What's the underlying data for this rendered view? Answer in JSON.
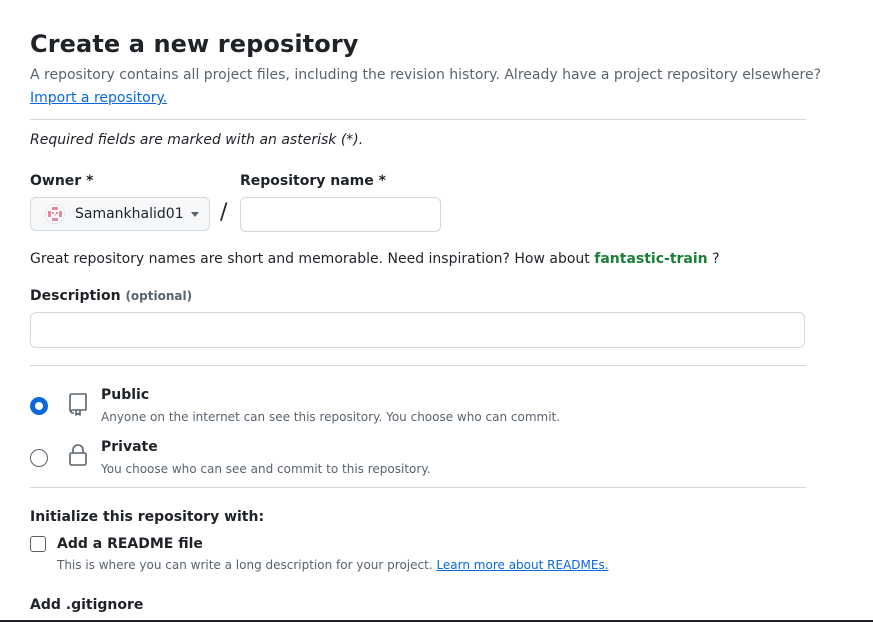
{
  "header": {
    "title": "Create a new repository",
    "subtitle": "A repository contains all project files, including the revision history. Already have a project repository elsewhere?",
    "import_link": "Import a repository."
  },
  "form": {
    "required_note": "Required fields are marked with an asterisk (*).",
    "owner": {
      "label": "Owner *",
      "value": "Samankhalid01",
      "avatar_icon": "identicon-avatar"
    },
    "separator": "/",
    "repo_name": {
      "label": "Repository name *",
      "value": "",
      "placeholder": ""
    },
    "hint": {
      "prefix": "Great repository names are short and memorable. Need inspiration? How about ",
      "suggestion": "fantastic-train",
      "suffix": " ?"
    },
    "description": {
      "label": "Description",
      "optional": "(optional)",
      "value": "",
      "placeholder": ""
    }
  },
  "visibility": {
    "selected": "public",
    "options": [
      {
        "id": "public",
        "title": "Public",
        "description": "Anyone on the internet can see this repository. You choose who can commit.",
        "icon": "repo-icon"
      },
      {
        "id": "private",
        "title": "Private",
        "description": "You choose who can see and commit to this repository.",
        "icon": "lock-icon"
      }
    ]
  },
  "initialize": {
    "heading": "Initialize this repository with:",
    "readme": {
      "label": "Add a README file",
      "checked": false,
      "description": "This is where you can write a long description for your project.",
      "learn_more": "Learn more about READMEs."
    },
    "gitignore_heading": "Add .gitignore"
  },
  "colors": {
    "link": "#0969da",
    "suggestion": "#1a7f37",
    "radio_selected": "#0969da",
    "muted_text": "#59636e",
    "border": "#d1d9e0"
  }
}
